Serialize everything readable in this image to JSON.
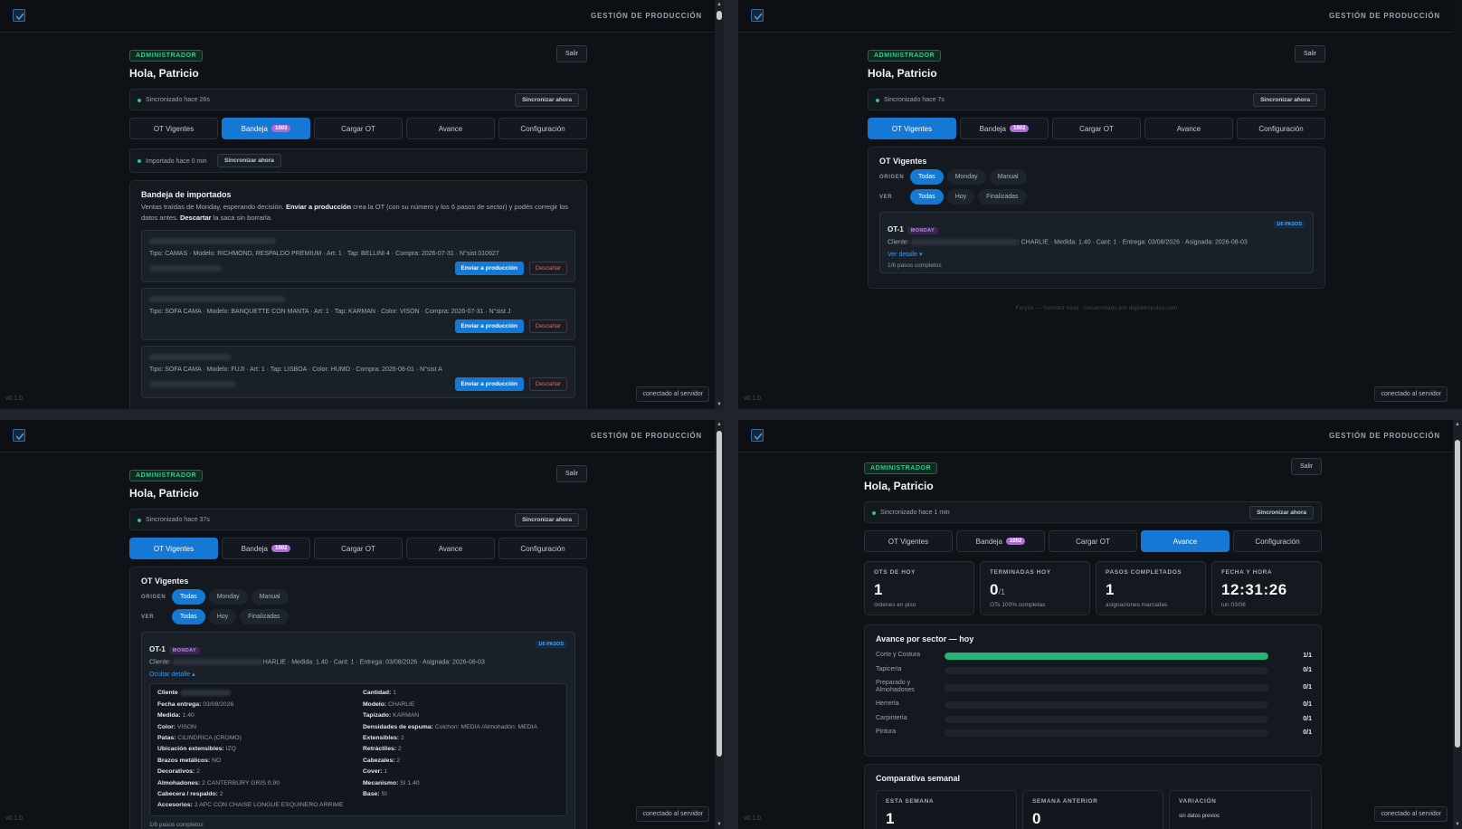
{
  "app": {
    "title": "GESTIÓN DE PRODUCCIÓN",
    "version": "v0.1.0",
    "connection": "conectado al servidor",
    "role": "ADMINISTRADOR",
    "greeting": "Hola, Patricio",
    "logout": "Salir",
    "sync_now": "Sincronizar ahora"
  },
  "tabs": [
    {
      "label": "OT Vigentes"
    },
    {
      "label": "Bandeja",
      "badge": "1003"
    },
    {
      "label": "Cargar OT"
    },
    {
      "label": "Avance"
    },
    {
      "label": "Configuración"
    }
  ],
  "tabs_alt_badge": "1002",
  "sync_status": {
    "tl": "Sincronizado hace 26s",
    "tr": "Sincronizado hace 7s",
    "bl": "Sincronizado hace 37s",
    "br": "Sincronizado hace 1 min"
  },
  "bandeja": {
    "import_status": "Importado hace 0 min",
    "title": "Bandeja de importados",
    "desc_1": "Ventas traídas de Monday, esperando decisión. ",
    "desc_bold_1": "Enviar a producción",
    "desc_2": " crea la OT (con su número y los 6 pasos de sector) y podés corregir los datos antes. ",
    "desc_bold_2": "Descartar",
    "desc_3": " la saca sin borrarla.",
    "send_label": "Enviar a producción",
    "discard_label": "Descartar",
    "items": [
      {
        "line": "Tipo: CAMAS · Modelo: RICHMOND, RESPALDO PREMIUM · Art: 1 · Tap: BELLINI 4 · Compra: 2026-07-31 · N°sist 010927"
      },
      {
        "line": "Tipo: SOFA CAMA · Modelo: BANQUETTE CON MANTA · Art: 1 · Tap: KARMAN · Color: VISON · Compra: 2026-07-31 · N°sist J"
      },
      {
        "line": "Tipo: SOFA CAMA · Modelo: FUJI · Art: 1 · Tap: LISBOA · Color: HUMO · Compra: 2026-08-01 · N°sist A"
      }
    ]
  },
  "vigentes": {
    "title": "OT Vigentes",
    "origen_label": "ORIGEN",
    "ver_label": "VER",
    "origen_chips": [
      "Todas",
      "Monday",
      "Manual"
    ],
    "ver_chips": [
      "Todas",
      "Hoy",
      "Finalizadas"
    ],
    "ot": {
      "id": "OT-1",
      "source": "MONDAY",
      "pasos_badge": "1/6 PASOS",
      "cliente_prefix": "Cliente:",
      "line_tr": ": CHARLIE · Medida: 1.40 · Cant: 1 · Entrega: 03/08/2026 · Asignada: 2026-08-03",
      "line_bl": "HARLIE · Medida: 1.40 · Cant: 1 · Entrega: 03/08/2026 · Asignada: 2026-08-03",
      "ver_detalle": "Ver detalle ▾",
      "ocultar_detalle": "Ocultar detalle ▴",
      "pasos": "1/6 pasos completos"
    },
    "footer": "Faryce — Servidor local · Desarrollado por digitalimpulso.com",
    "detail_left": [
      {
        "k": "Cliente",
        "v": ""
      },
      {
        "k": "Fecha entrega:",
        "v": "03/08/2026"
      },
      {
        "k": "Medida:",
        "v": "1.40"
      },
      {
        "k": "Color:",
        "v": "VISON"
      },
      {
        "k": "Patas:",
        "v": "CILINDRICA (CROMO)"
      },
      {
        "k": "Ubicación extensibles:",
        "v": "IZQ"
      },
      {
        "k": "Brazos metálicos:",
        "v": "NO"
      },
      {
        "k": "Decorativos:",
        "v": "2"
      },
      {
        "k": "Almohadones:",
        "v": "2 CANTERBURY GRIS 0.90"
      },
      {
        "k": "Cabecera / respaldo:",
        "v": "2"
      },
      {
        "k": "Accesorios:",
        "v": "2 APC CON CHAISE LONGUE ESQUINERO ARRIME"
      }
    ],
    "detail_right": [
      {
        "k": "Cantidad:",
        "v": "1"
      },
      {
        "k": "Modelo:",
        "v": "CHARLIE"
      },
      {
        "k": "Tapizado:",
        "v": "KARMAN"
      },
      {
        "k": "Densidades de espuma:",
        "v": "Colchon: MEDIA /Almohadón: MEDIA"
      },
      {
        "k": "Extensibles:",
        "v": "2"
      },
      {
        "k": "Retráctiles:",
        "v": "2"
      },
      {
        "k": "Cabezales:",
        "v": "2"
      },
      {
        "k": "Cover:",
        "v": "1"
      },
      {
        "k": "Mecanismo:",
        "v": "SI 1.40"
      },
      {
        "k": "Base:",
        "v": "SI"
      }
    ]
  },
  "avance": {
    "stats": [
      {
        "label": "OTS DE HOY",
        "value": "1",
        "suffix": "",
        "sub": "órdenes en piso"
      },
      {
        "label": "TERMINADAS HOY",
        "value": "0",
        "suffix": "/1",
        "sub": "OTs 100% completas"
      },
      {
        "label": "PASOS COMPLETADOS",
        "value": "1",
        "suffix": "",
        "sub": "asignaciones marcadas"
      },
      {
        "label": "FECHA Y HORA",
        "value": "12:31:26",
        "suffix": "",
        "sub": "lun 03/08"
      }
    ],
    "sector_title": "Avance por sector — hoy",
    "sectors": [
      {
        "name": "Corte y Costura",
        "count": "1/1",
        "progress": 1.0
      },
      {
        "name": "Tapicería",
        "count": "0/1",
        "progress": 0
      },
      {
        "name": "Preparado y Almohadones",
        "count": "0/1",
        "progress": 0
      },
      {
        "name": "Herrería",
        "count": "0/1",
        "progress": 0
      },
      {
        "name": "Carpintería",
        "count": "0/1",
        "progress": 0
      },
      {
        "name": "Pintura",
        "count": "0/1",
        "progress": 0
      }
    ],
    "weekly_title": "Comparativa semanal",
    "weekly": [
      {
        "label": "ESTA SEMANA",
        "value": "1"
      },
      {
        "label": "SEMANA ANTERIOR",
        "value": "0"
      },
      {
        "label": "VARIACIÓN",
        "value": "sin datos previos"
      }
    ]
  },
  "colors": {
    "accent": "#1478d4",
    "success": "#25b57a",
    "badge": "#b06ad8",
    "danger": "#e06868"
  }
}
